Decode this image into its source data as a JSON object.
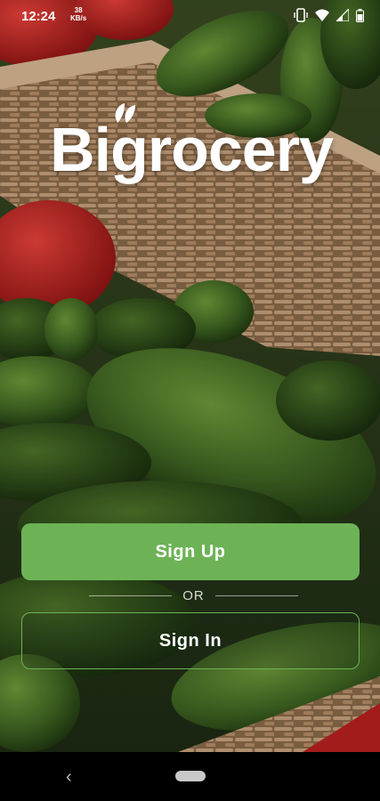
{
  "status_bar": {
    "time": "12:24",
    "net_speed_value": "38",
    "net_speed_unit": "KB/s",
    "icons": [
      "vibrate-icon",
      "wifi-icon",
      "signal-icon",
      "battery-icon"
    ]
  },
  "app": {
    "logo_text": "Bigrocery",
    "brand_color": "#6db356"
  },
  "auth": {
    "signup_label": "Sign Up",
    "or_label": "OR",
    "signin_label": "Sign In"
  },
  "nav_bar": {
    "back_symbol": "‹",
    "icons": [
      "back-icon",
      "home-pill-icon"
    ]
  }
}
